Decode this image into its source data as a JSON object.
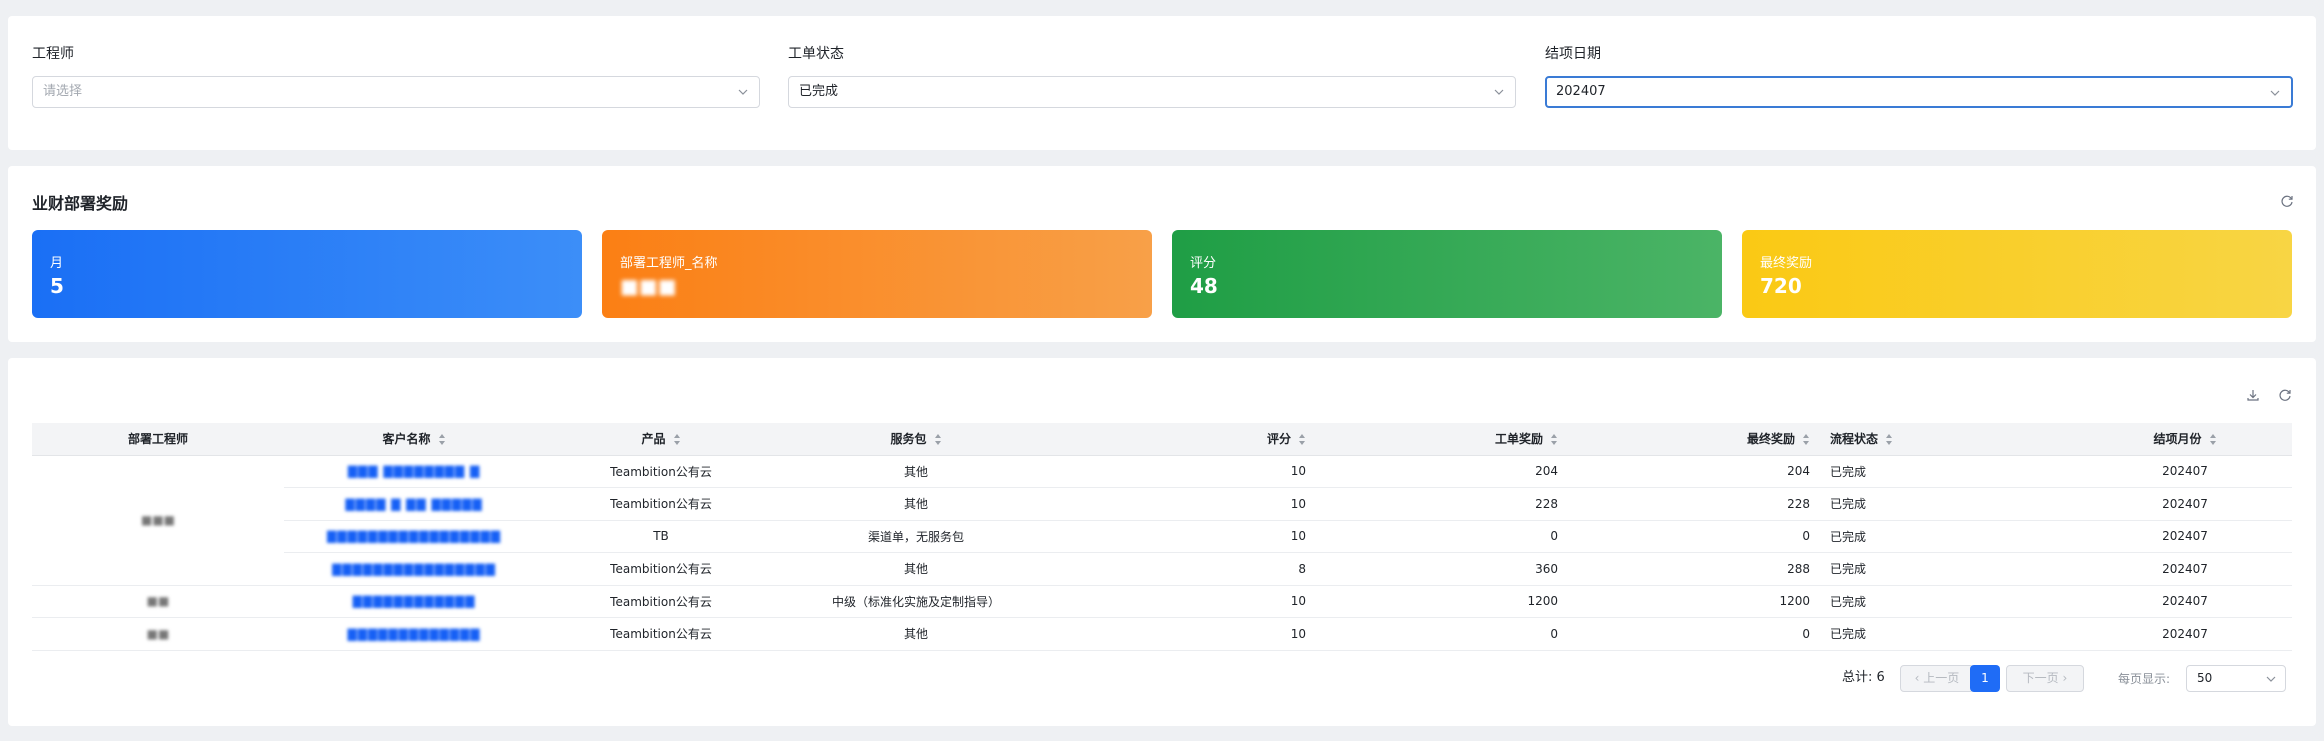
{
  "filters": {
    "engineer": {
      "label": "工程师",
      "placeholder": "请选择"
    },
    "status": {
      "label": "工单状态",
      "value": "已完成"
    },
    "date": {
      "label": "结项日期",
      "value": "202407"
    }
  },
  "kpi": {
    "title": "业财部署奖励",
    "tiles": [
      {
        "label": "月",
        "value": "5",
        "color": "#1a6ff5"
      },
      {
        "label": "部署工程师_名称",
        "value": "■■■",
        "color": "#fb7f14"
      },
      {
        "label": "评分",
        "value": "48",
        "color": "#1f9e45"
      },
      {
        "label": "最终奖励",
        "value": "720",
        "color": "#fac914"
      }
    ]
  },
  "table": {
    "columns": [
      "部署工程师",
      "客户名称",
      "产品",
      "服务包",
      "评分",
      "工单奖励",
      "最终奖励",
      "流程状态",
      "结项月份"
    ],
    "rows": [
      {
        "engineer": "■■■",
        "customer": "▇▇▇ ▇▇▇▇▇▇▇▇ ▇",
        "product": "Teambition公有云",
        "package": "其他",
        "score": "10",
        "order_reward": "204",
        "final_reward": "204",
        "status": "已完成",
        "month": "202407"
      },
      {
        "engineer": "",
        "customer": "▇▇▇▇ ▇ ▇▇ ▇▇▇▇▇",
        "product": "Teambition公有云",
        "package": "其他",
        "score": "10",
        "order_reward": "228",
        "final_reward": "228",
        "status": "已完成",
        "month": "202407"
      },
      {
        "engineer": "",
        "customer": "▇▇▇▇▇▇▇▇▇▇▇▇▇▇▇▇▇",
        "product": "TB",
        "package": "渠道单，无服务包",
        "score": "10",
        "order_reward": "0",
        "final_reward": "0",
        "status": "已完成",
        "month": "202407"
      },
      {
        "engineer": "",
        "customer": "▇▇▇▇▇▇▇▇▇▇▇▇▇▇▇▇",
        "product": "Teambition公有云",
        "package": "其他",
        "score": "8",
        "order_reward": "360",
        "final_reward": "288",
        "status": "已完成",
        "month": "202407"
      },
      {
        "engineer": "■■",
        "customer": "▇▇▇▇▇▇▇▇▇▇▇▇",
        "product": "Teambition公有云",
        "package": "中级（标准化实施及定制指导）",
        "score": "10",
        "order_reward": "1200",
        "final_reward": "1200",
        "status": "已完成",
        "month": "202407"
      },
      {
        "engineer": "■■",
        "customer": "▇▇▇▇▇▇▇▇▇▇▇▇▇",
        "product": "Teambition公有云",
        "package": "其他",
        "score": "10",
        "order_reward": "0",
        "final_reward": "0",
        "status": "已完成",
        "month": "202407"
      }
    ]
  },
  "pagination": {
    "total": "总计: 6",
    "prev": "上一页",
    "page": "1",
    "next": "下一页",
    "page_size_label": "每页显示:",
    "page_size": "50"
  },
  "icons": {
    "dropdown": "chevron-down-icon",
    "refresh": "refresh-icon",
    "download": "download-icon"
  }
}
